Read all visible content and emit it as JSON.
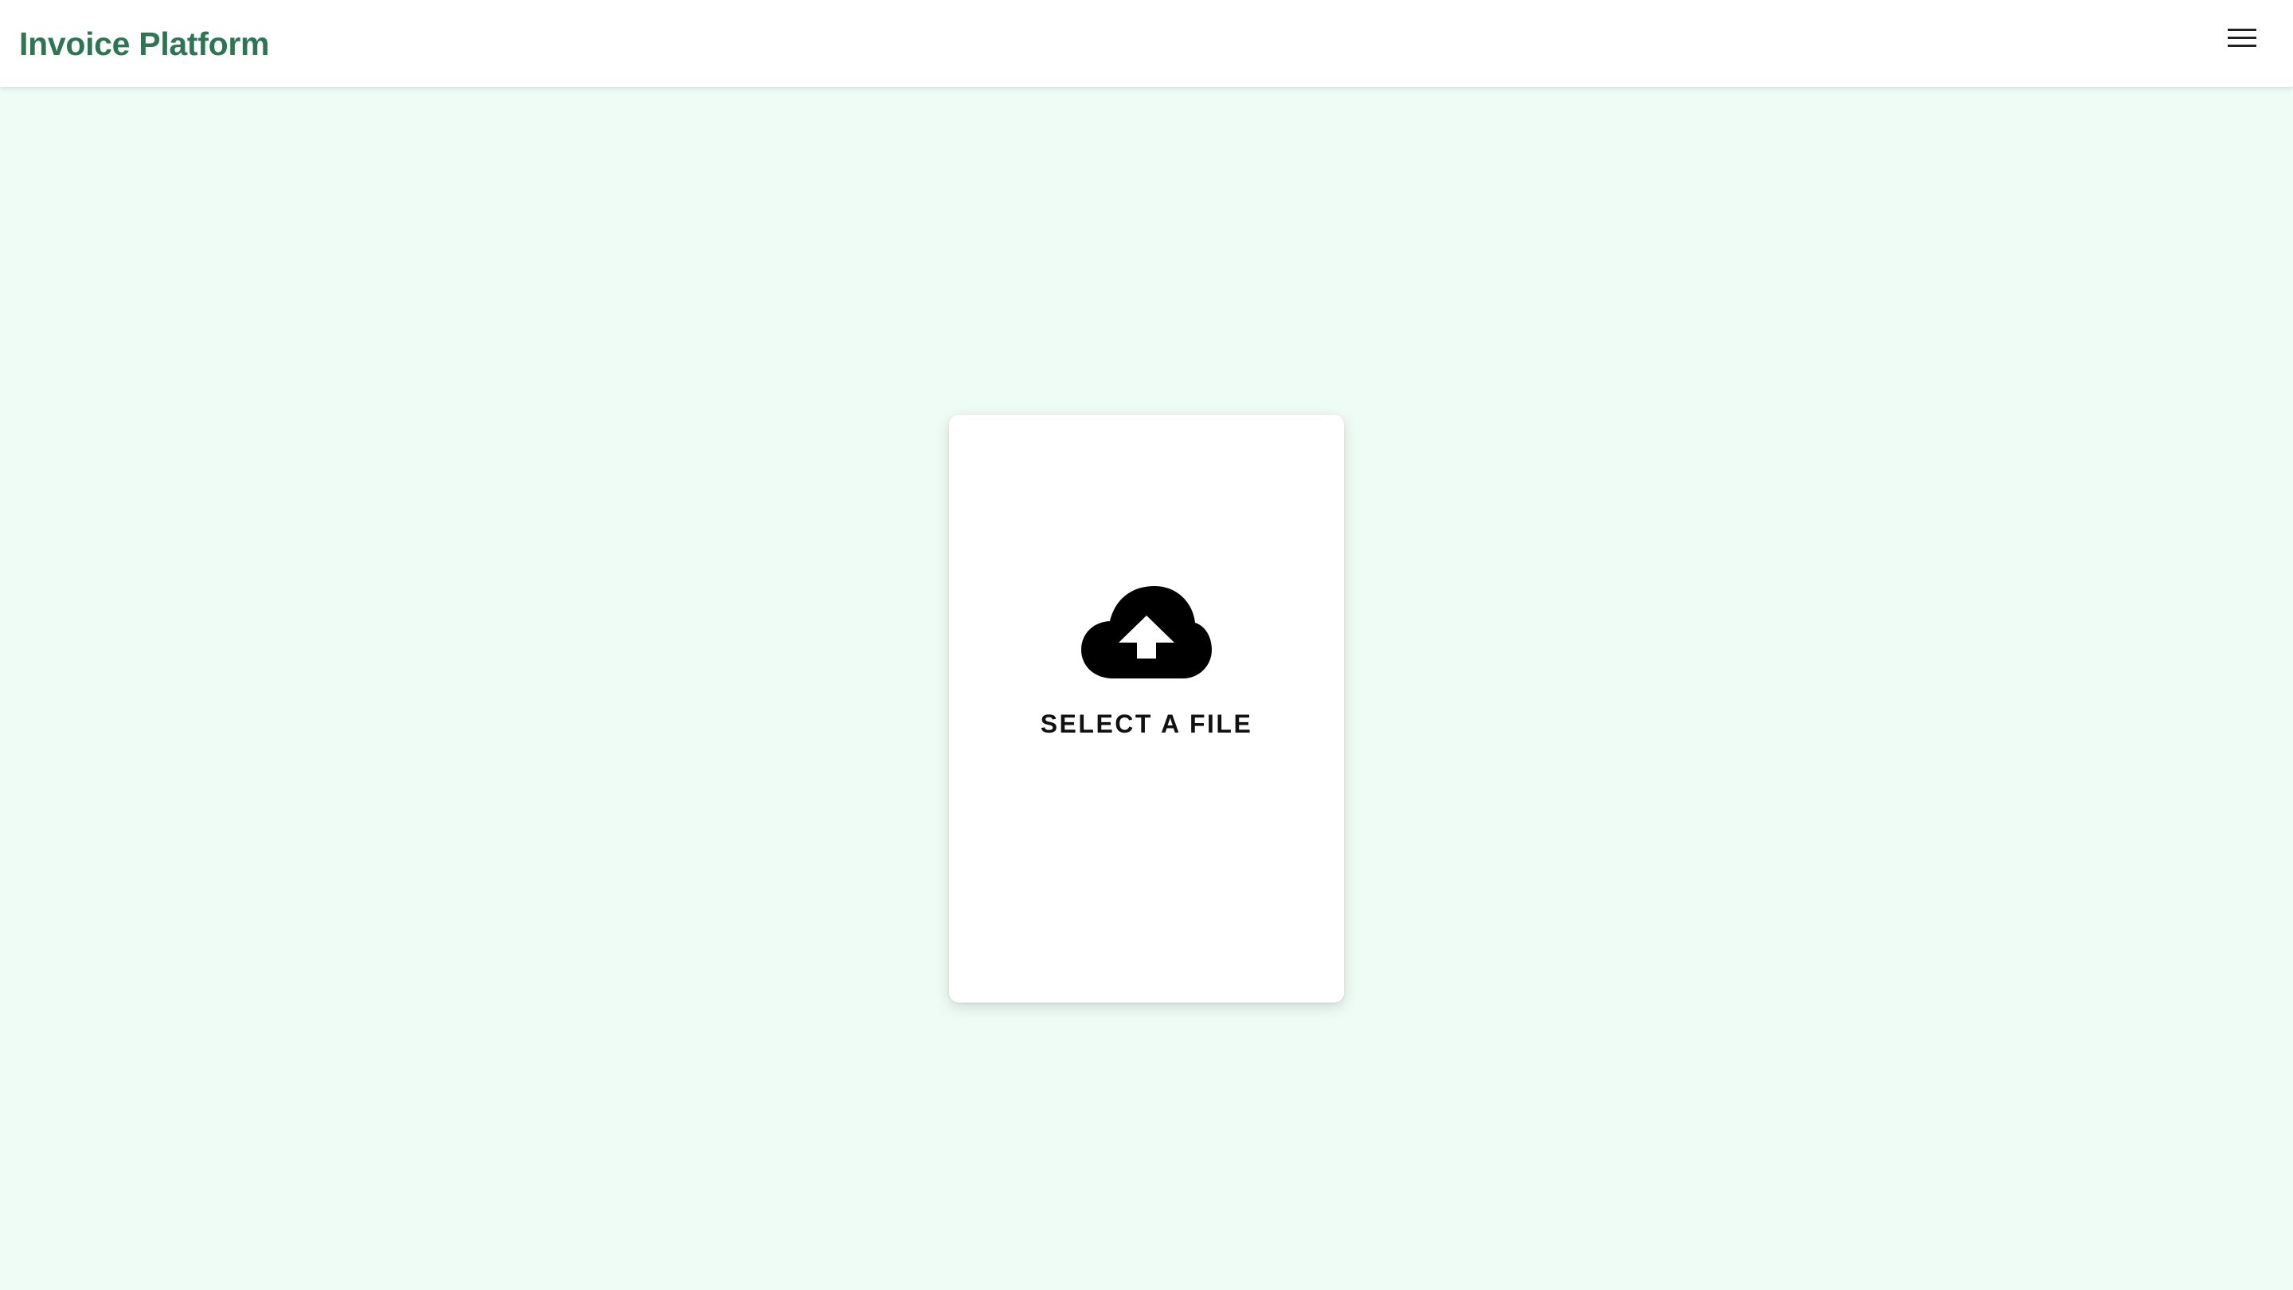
{
  "header": {
    "app_title": "Invoice Platform",
    "menu_icon": "hamburger-menu-icon"
  },
  "upload": {
    "icon": "cloud-upload-icon",
    "label": "SELECT A FILE"
  },
  "colors": {
    "page_background": "#effbf5",
    "brand": "#2e7553",
    "card_background": "#ffffff",
    "text": "#111111"
  }
}
